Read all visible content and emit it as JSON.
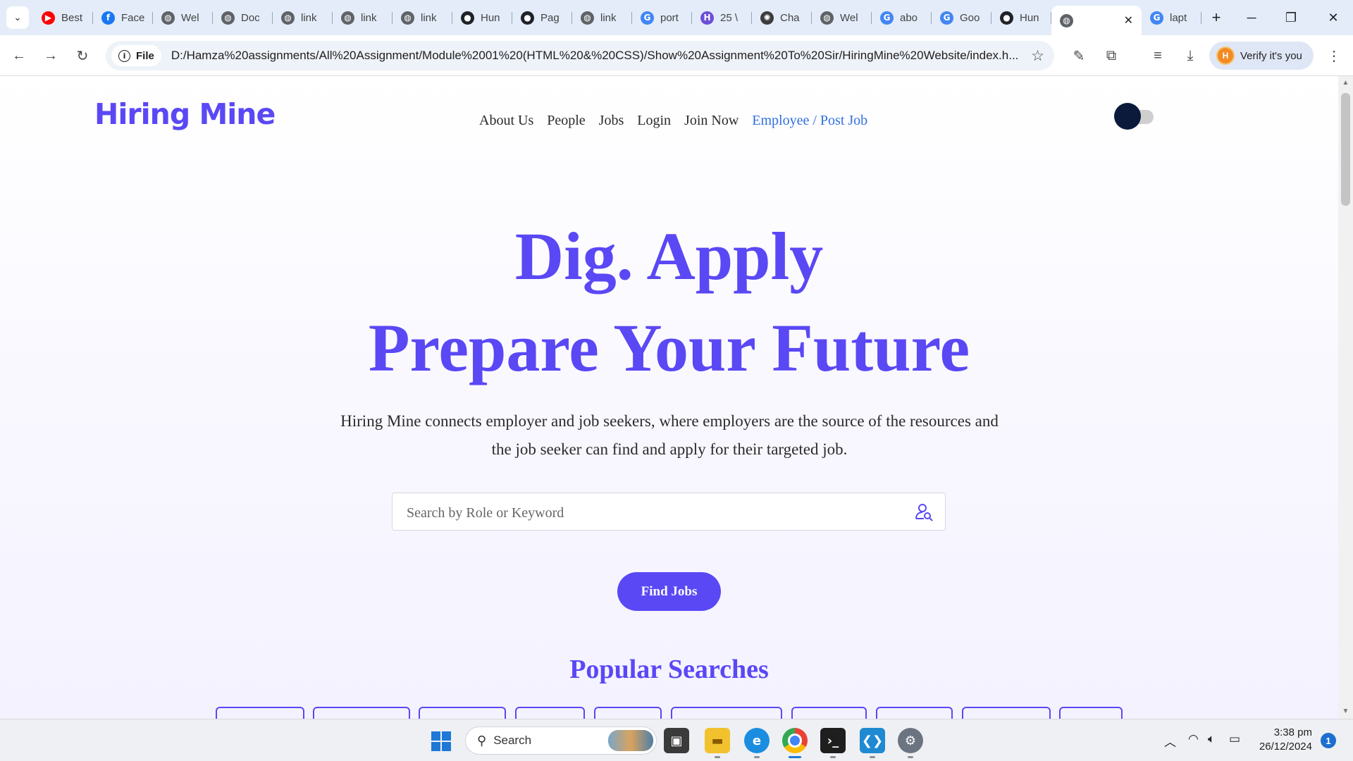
{
  "browser": {
    "tabs": [
      {
        "title": "Best",
        "favicon": "youtube-icon",
        "color": "#ff0000",
        "glyph": "▶"
      },
      {
        "title": "Face",
        "favicon": "facebook-icon",
        "color": "#1877f2",
        "glyph": "f"
      },
      {
        "title": "Wel",
        "favicon": "globe-icon",
        "color": "#5f6368",
        "glyph": "◍"
      },
      {
        "title": "Doc",
        "favicon": "globe-icon",
        "color": "#5f6368",
        "glyph": "◍"
      },
      {
        "title": "link",
        "favicon": "globe-icon",
        "color": "#5f6368",
        "glyph": "◍"
      },
      {
        "title": "link",
        "favicon": "globe-icon",
        "color": "#5f6368",
        "glyph": "◍"
      },
      {
        "title": "link",
        "favicon": "globe-icon",
        "color": "#5f6368",
        "glyph": "◍"
      },
      {
        "title": "Hun",
        "favicon": "github-icon",
        "color": "#1f2328",
        "glyph": "●"
      },
      {
        "title": "Pag",
        "favicon": "github-icon",
        "color": "#1f2328",
        "glyph": "●"
      },
      {
        "title": "link",
        "favicon": "globe-icon",
        "color": "#5f6368",
        "glyph": "◍"
      },
      {
        "title": "port",
        "favicon": "google-icon",
        "color": "#4285f4",
        "glyph": "G"
      },
      {
        "title": "25 \\",
        "favicon": "hackerrank-icon",
        "color": "#6b4fd8",
        "glyph": "H"
      },
      {
        "title": "Cha",
        "favicon": "chatgpt-icon",
        "color": "#3c3c3c",
        "glyph": "✺"
      },
      {
        "title": "Wel",
        "favicon": "globe-icon",
        "color": "#5f6368",
        "glyph": "◍"
      },
      {
        "title": "abo",
        "favicon": "google-icon",
        "color": "#4285f4",
        "glyph": "G"
      },
      {
        "title": "Goo",
        "favicon": "google-icon",
        "color": "#4285f4",
        "glyph": "G"
      },
      {
        "title": "Hun",
        "favicon": "github-icon",
        "color": "#1f2328",
        "glyph": "●"
      }
    ],
    "active_tab": {
      "favicon": "globe-icon",
      "close": "✕"
    },
    "after_tabs": [
      {
        "title": "lapt",
        "favicon": "google-icon",
        "color": "#4285f4",
        "glyph": "G"
      }
    ],
    "new_tab": "+",
    "address": {
      "chip_label": "File",
      "url": "D:/Hamza%20assignments/All%20Assignment/Module%2001%20(HTML%20&%20CSS)/Show%20Assignment%20To%20Sir/HiringMine%20Website/index.h..."
    },
    "profile": {
      "initial": "H",
      "label": "Verify it's you"
    }
  },
  "site": {
    "logo": "Hiring Mine",
    "nav": [
      "About Us",
      "People",
      "Jobs",
      "Login",
      "Join Now"
    ],
    "nav_cta": "Employee / Post Job",
    "hero_line1": "Dig. Apply",
    "hero_line2": "Prepare Your Future",
    "description": "Hiring Mine connects employer and job seekers, where employers are the source of the resources and the job seeker can find and apply for their targeted job.",
    "search_placeholder": "Search by Role or Keyword",
    "find_jobs": "Find Jobs",
    "popular_title": "Popular Searches",
    "accent_color": "#5a48f5"
  },
  "taskbar": {
    "search_label": "Search",
    "time": "3:38 pm",
    "date": "26/12/2024",
    "notifications": "1"
  }
}
